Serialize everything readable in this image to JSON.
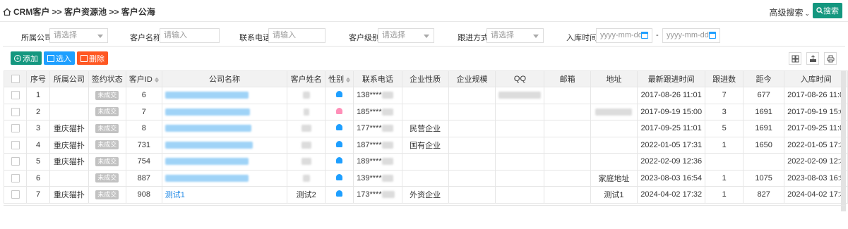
{
  "breadcrumb": "CRM客户 >> 客户资源池 >> 客户公海",
  "header": {
    "advanced_search": "高级搜索",
    "search_button": "搜索"
  },
  "filters": {
    "company_label": "所属公司",
    "company_placeholder": "请选择",
    "name_label": "客户名称",
    "name_placeholder": "请输入",
    "phone_label": "联系电话",
    "phone_placeholder": "请输入",
    "level_label": "客户级别",
    "level_placeholder": "请选择",
    "followup_label": "跟进方式",
    "followup_placeholder": "请选择",
    "storage_label": "入库时间",
    "date_start_placeholder": "yyyy-mm-dd",
    "date_sep": "-",
    "date_end_placeholder": "yyyy-mm-dd"
  },
  "toolbar": {
    "add": "添加",
    "select": "选入",
    "delete": "删除"
  },
  "columns": [
    "序号",
    "所属公司",
    "签约状态",
    "客户ID",
    "公司名称",
    "客户姓名",
    "性别",
    "联系电话",
    "企业性质",
    "企业规模",
    "QQ",
    "邮箱",
    "地址",
    "最新跟进时间",
    "跟进数",
    "距今",
    "入库时间"
  ],
  "colors": {
    "accent": "#14977f",
    "add_btn": "#14977f",
    "select_btn": "#1e9fff",
    "delete_btn": "#ff5722",
    "male": "#1e9fff",
    "female": "#ff8fb8",
    "link": "#1e88e5"
  },
  "rows": [
    {
      "no": "1",
      "company": "",
      "status": "未成交",
      "id": "6",
      "company_name": "",
      "customer": "",
      "gender": "male",
      "phone": "138****",
      "nature": "",
      "scale": "",
      "qq": "",
      "email": "",
      "address": "",
      "latest": "2017-08-26 11:01",
      "follow": "7",
      "days": "677",
      "stored": "2017-08-26 11:0"
    },
    {
      "no": "2",
      "company": "",
      "status": "未成交",
      "id": "7",
      "company_name": "",
      "customer": "",
      "gender": "female",
      "phone": "185****",
      "nature": "",
      "scale": "",
      "qq": "",
      "email": "",
      "address": "",
      "latest": "2017-09-19 15:00",
      "follow": "3",
      "days": "1691",
      "stored": "2017-09-19 15:0"
    },
    {
      "no": "3",
      "company": "重庆猫扑",
      "status": "未成交",
      "id": "8",
      "company_name": "",
      "customer": "",
      "gender": "male",
      "phone": "177****",
      "nature": "民营企业",
      "scale": "",
      "qq": "",
      "email": "",
      "address": "",
      "latest": "2017-09-25 11:01",
      "follow": "5",
      "days": "1691",
      "stored": "2017-09-25 11:0"
    },
    {
      "no": "4",
      "company": "重庆猫扑",
      "status": "未成交",
      "id": "731",
      "company_name": "",
      "customer": "",
      "gender": "male",
      "phone": "187****",
      "nature": "国有企业",
      "scale": "",
      "qq": "",
      "email": "",
      "address": "",
      "latest": "2022-01-05 17:31",
      "follow": "1",
      "days": "1650",
      "stored": "2022-01-05 17:3"
    },
    {
      "no": "5",
      "company": "重庆猫扑",
      "status": "未成交",
      "id": "754",
      "company_name": "",
      "customer": "",
      "gender": "male",
      "phone": "189****",
      "nature": "",
      "scale": "",
      "qq": "",
      "email": "",
      "address": "",
      "latest": "2022-02-09 12:36",
      "follow": "",
      "days": "",
      "stored": "2022-02-09 12:3"
    },
    {
      "no": "6",
      "company": "",
      "status": "未成交",
      "id": "887",
      "company_name": "",
      "customer": "",
      "gender": "male",
      "phone": "139****",
      "nature": "",
      "scale": "",
      "qq": "",
      "email": "",
      "address": "家庭地址",
      "latest": "2023-08-03 16:54",
      "follow": "1",
      "days": "1075",
      "stored": "2023-08-03 16:5"
    },
    {
      "no": "7",
      "company": "重庆猫扑",
      "status": "未成交",
      "id": "908",
      "company_name": "测试1",
      "customer": "测试2",
      "gender": "male",
      "phone": "173****",
      "nature": "外资企业",
      "scale": "",
      "qq": "",
      "email": "",
      "address": "测试1",
      "latest": "2024-04-02 17:32",
      "follow": "1",
      "days": "827",
      "stored": "2024-04-02 17:3"
    }
  ]
}
